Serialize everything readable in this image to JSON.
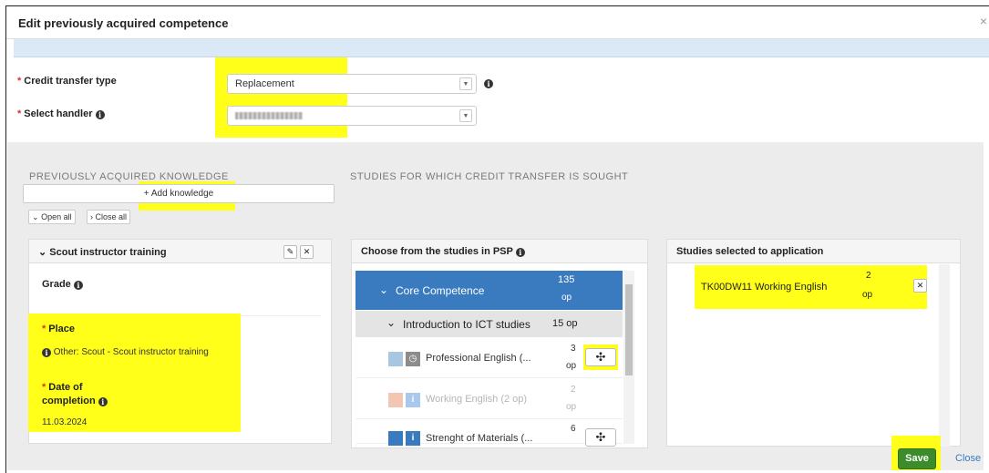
{
  "modal": {
    "title": "Edit previously acquired competence",
    "close_symbol": "×"
  },
  "form": {
    "credit_type_label": "Credit transfer type",
    "credit_type_value": "Replacement",
    "handler_label": "Select handler",
    "required_mark": "*"
  },
  "left": {
    "header": "PREVIOUSLY ACQUIRED KNOWLEDGE",
    "add_label": "Add knowledge",
    "open_all": "Open all",
    "close_all": "Close all",
    "item_title": "Scout instructor training",
    "grade_label": "Grade",
    "place_label": "Place",
    "place_value": "Other: Scout - Scout instructor training",
    "date_label_1": "Date of",
    "date_label_2": "completion",
    "date_value": "11.03.2024"
  },
  "middle": {
    "header": "STUDIES FOR WHICH CREDIT TRANSFER IS SOUGHT",
    "panel_title": "Choose from the studies in PSP",
    "core": {
      "label": "Core Competence",
      "credits": "135",
      "unit": "op"
    },
    "sub": {
      "label": "Introduction to ICT studies",
      "credits": "15 op"
    },
    "courses": [
      {
        "label": "Professional English (...",
        "credits": "3",
        "unit": "op"
      },
      {
        "label": "Working English (2 op)",
        "credits": "2",
        "unit": "op"
      },
      {
        "label": "Strenght of Materials (...",
        "credits": "6",
        "unit": "op"
      }
    ]
  },
  "right": {
    "panel_title": "Studies selected to application",
    "selected": {
      "label": "TK00DW11 Working English",
      "credits": "2",
      "unit": "op"
    }
  },
  "footer": {
    "save": "Save",
    "close": "Close"
  },
  "colors": {
    "highlight": "#ffff1a",
    "primary": "#3a7bbf",
    "save": "#3c8c2c"
  }
}
